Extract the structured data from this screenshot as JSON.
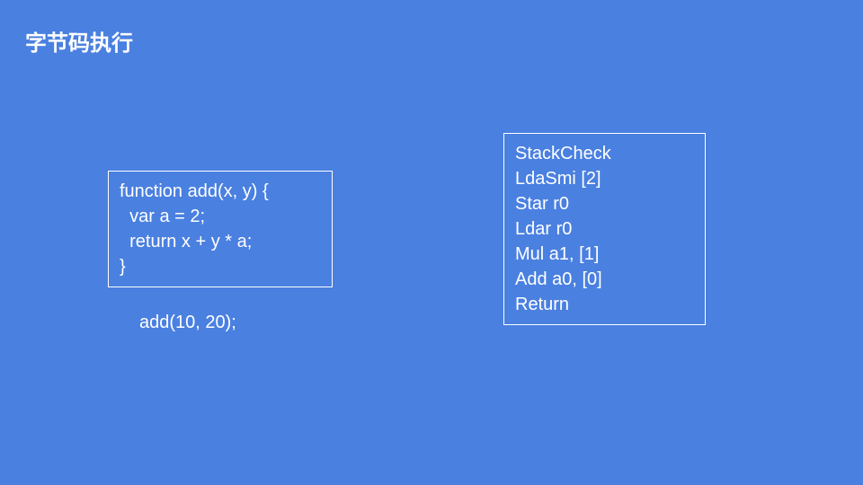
{
  "title": "字节码执行",
  "source_code": "function add(x, y) {\n  var a = 2;\n  return x + y * a;\n}",
  "call_expression": "add(10, 20);",
  "bytecode": "StackCheck\nLdaSmi [2]\nStar r0\nLdar r0\nMul a1, [1]\nAdd a0, [0]\nReturn"
}
